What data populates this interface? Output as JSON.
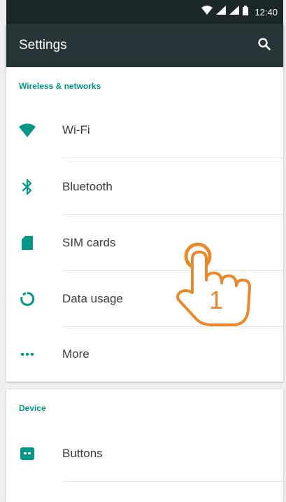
{
  "status_bar": {
    "time": "12:40",
    "icons": [
      "wifi-icon",
      "signal-icon",
      "signal-icon",
      "battery-icon"
    ]
  },
  "app_bar": {
    "title": "Settings",
    "search_icon": "search-icon"
  },
  "sections": {
    "wireless": {
      "header": "Wireless & networks",
      "items": [
        {
          "label": "Wi-Fi",
          "icon": "wifi-icon"
        },
        {
          "label": "Bluetooth",
          "icon": "bluetooth-icon"
        },
        {
          "label": "SIM cards",
          "icon": "sim-card-icon"
        },
        {
          "label": "Data usage",
          "icon": "data-usage-icon"
        },
        {
          "label": "More",
          "icon": "more-dots-icon"
        }
      ]
    },
    "device": {
      "header": "Device",
      "items": [
        {
          "label": "Buttons",
          "icon": "buttons-icon"
        }
      ]
    }
  },
  "overlay": {
    "step_number": "1",
    "hand_icon": "pointing-hand-icon"
  },
  "colors": {
    "accent": "#009688",
    "app_bar": "#263537",
    "status_bar": "#1a2628",
    "hand": "#e8892b"
  }
}
